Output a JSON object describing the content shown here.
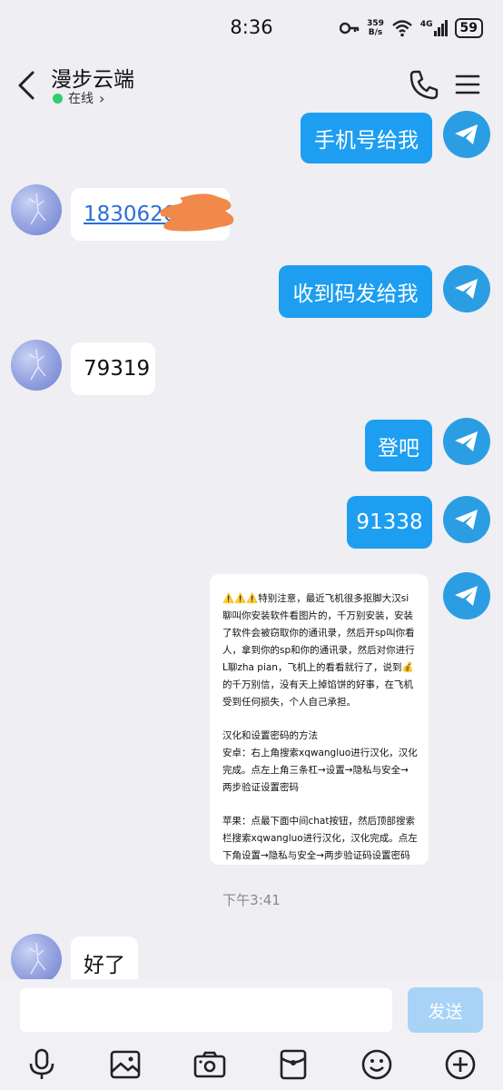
{
  "status": {
    "time": "8:36",
    "speed_top": "359",
    "speed_bottom": "B/s",
    "network": "4G",
    "battery": "59"
  },
  "header": {
    "title": "漫步云端",
    "status": "在线",
    "status_chevron": "›"
  },
  "messages": [
    {
      "side": "out",
      "text": "手机号给我"
    },
    {
      "side": "in",
      "text": "18306206"
    },
    {
      "side": "out",
      "text": "收到码发给我"
    },
    {
      "side": "in",
      "text": "79319"
    },
    {
      "side": "out",
      "text": "登吧"
    },
    {
      "side": "out",
      "text": "91338"
    },
    {
      "side": "out",
      "notice": [
        "⚠️⚠️⚠️特别注意，最近飞机很多抠脚大汉si聊叫你安装软件看图片的，千万别安装，安装了软件会被窃取你的通讯录，然后开sp叫你看人，拿到你的sp和你的通讯录，然后对你进行L聊zha pian，飞机上的看看就行了，说到💰的千万别信，没有天上掉馅饼的好事，在飞机受到任何损失，个人自己承担。",
        "汉化和设置密码的方法\n安卓：右上角搜索xqwangluo进行汉化，汉化完成。点左上角三条杠→设置→隐私与安全→两步验证设置密码",
        "苹果：点最下面中间chat按钮，然后顶部搜索栏搜索xqwangluo进行汉化，汉化完成。点左下角设置→隐私与安全→两步验证码设置密码"
      ]
    },
    {
      "side": "in",
      "text": "好了"
    }
  ],
  "timestamp": "下午3:41",
  "composer": {
    "placeholder": "",
    "send_label": "发送"
  },
  "toolbar": [
    "microphone-icon",
    "image-icon",
    "camera-icon",
    "envelope-icon",
    "emoji-icon",
    "plus-icon"
  ],
  "colors": {
    "bubble_out": "#1e9ef0",
    "telegram": "#2b9ee3",
    "online": "#2fcf6b",
    "send_disabled": "#a8d3f6"
  }
}
